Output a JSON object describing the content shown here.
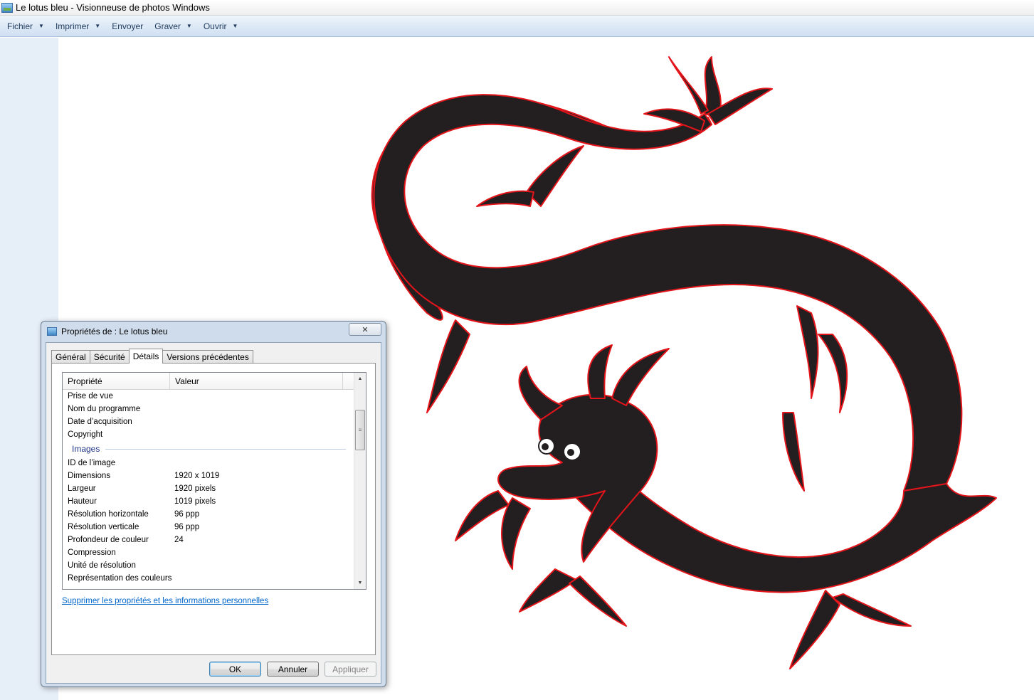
{
  "window": {
    "title": "Le lotus bleu - Visionneuse de photos Windows"
  },
  "menu": {
    "items": [
      {
        "label": "Fichier",
        "has_dropdown": true
      },
      {
        "label": "Imprimer",
        "has_dropdown": true
      },
      {
        "label": "Envoyer",
        "has_dropdown": false
      },
      {
        "label": "Graver",
        "has_dropdown": true
      },
      {
        "label": "Ouvrir",
        "has_dropdown": true
      }
    ]
  },
  "image": {
    "subject": "dragon-illustration",
    "colors": {
      "body": "#231f20",
      "outline": "#e3141a",
      "eyes": "#ffffff"
    }
  },
  "dialog": {
    "title": "Propriétés de : Le lotus bleu",
    "tabs": [
      "Général",
      "Sécurité",
      "Détails",
      "Versions précédentes"
    ],
    "active_tab": "Détails",
    "columns": {
      "property": "Propriété",
      "value": "Valeur"
    },
    "rows_top": [
      {
        "k": "Prise de vue",
        "v": ""
      },
      {
        "k": "Nom du programme",
        "v": ""
      },
      {
        "k": "Date d’acquisition",
        "v": ""
      },
      {
        "k": "Copyright",
        "v": ""
      }
    ],
    "group_label": "Images",
    "rows_images": [
      {
        "k": "ID de l’image",
        "v": ""
      },
      {
        "k": "Dimensions",
        "v": "1920 x 1019"
      },
      {
        "k": "Largeur",
        "v": "1920 pixels"
      },
      {
        "k": "Hauteur",
        "v": "1019 pixels"
      },
      {
        "k": "Résolution horizontale",
        "v": "96 ppp"
      },
      {
        "k": "Résolution verticale",
        "v": "96 ppp"
      },
      {
        "k": "Profondeur de couleur",
        "v": "24"
      },
      {
        "k": "Compression",
        "v": ""
      },
      {
        "k": "Unité de résolution",
        "v": ""
      },
      {
        "k": "Représentation des couleurs",
        "v": ""
      }
    ],
    "remove_link": "Supprimer les propriétés et les informations personnelles",
    "buttons": {
      "ok": "OK",
      "cancel": "Annuler",
      "apply": "Appliquer"
    },
    "close_glyph": "✕"
  },
  "glyphs": {
    "dropdown": "▼",
    "scroll_up": "▲",
    "scroll_down": "▼",
    "grip": "≡"
  }
}
